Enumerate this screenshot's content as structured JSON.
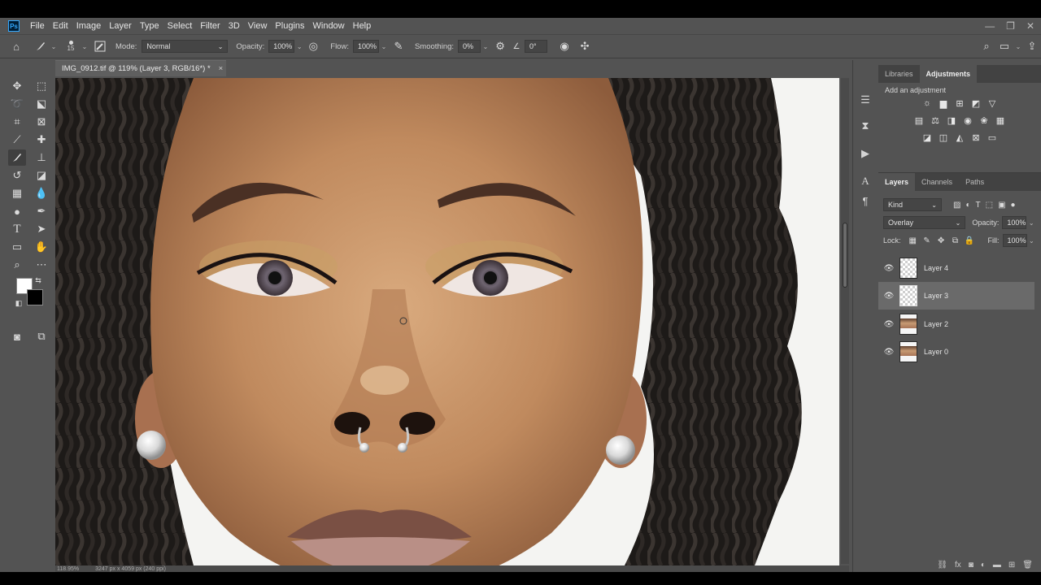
{
  "app": {
    "logo": "Ps",
    "menu": [
      "File",
      "Edit",
      "Image",
      "Layer",
      "Type",
      "Select",
      "Filter",
      "3D",
      "View",
      "Plugins",
      "Window",
      "Help"
    ],
    "window_controls": [
      "—",
      "❐",
      "✕"
    ]
  },
  "options": {
    "brush_size": "15",
    "mode_label": "Mode:",
    "mode_value": "Normal",
    "opacity_label": "Opacity:",
    "opacity_value": "100%",
    "flow_label": "Flow:",
    "flow_value": "100%",
    "smoothing_label": "Smoothing:",
    "smoothing_value": "0%",
    "angle_value": "0°"
  },
  "document": {
    "tab_title": "IMG_0912.tif @ 119% (Layer 3, RGB/16*) *",
    "close": "×",
    "zoom_status": "118.95%",
    "size_status": "3247 px x 4059 px (240 ppi)"
  },
  "panels": {
    "top_tabs": [
      "Libraries",
      "Adjustments"
    ],
    "adjustments_label": "Add an adjustment",
    "layer_tabs": [
      "Layers",
      "Channels",
      "Paths"
    ],
    "filter_kind": "Kind",
    "blend_mode": "Overlay",
    "opacity_label": "Opacity:",
    "opacity_value": "100%",
    "lock_label": "Lock:",
    "fill_label": "Fill:",
    "fill_value": "100%"
  },
  "layers": [
    {
      "name": "Layer 4",
      "thumb": "transparent",
      "selected": false
    },
    {
      "name": "Layer 3",
      "thumb": "transparent",
      "selected": true
    },
    {
      "name": "Layer 2",
      "thumb": "photo",
      "selected": false
    },
    {
      "name": "Layer 0",
      "thumb": "photo",
      "selected": false
    }
  ],
  "colors": {
    "panel_bg": "#535353",
    "selected_layer": "#6a6a6a",
    "skin": "#c08a5e"
  }
}
